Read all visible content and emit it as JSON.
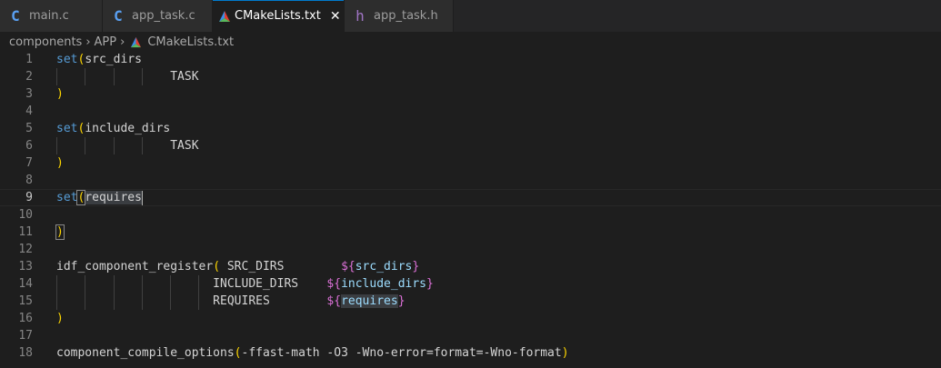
{
  "tabs": [
    {
      "icon": "C",
      "label": "main.c",
      "active": false
    },
    {
      "icon": "C",
      "label": "app_task.c",
      "active": false
    },
    {
      "icon": "cmake",
      "label": "CMakeLists.txt",
      "active": true
    },
    {
      "icon": "h",
      "label": "app_task.h",
      "active": false
    }
  ],
  "breadcrumb": [
    "components",
    "APP",
    "CMakeLists.txt"
  ],
  "colors": {
    "keyword": "#569cd6",
    "bracket": "#ffd700",
    "variable": "#9cdcfe",
    "dollar_brace": "#da70d6",
    "text": "#d4d4d4",
    "background": "#1e1e1e"
  },
  "current_line": 9,
  "lines": [
    {
      "n": "1",
      "tokens": [
        {
          "t": "set",
          "c": "fn"
        },
        {
          "t": "(",
          "c": "pn"
        },
        {
          "t": "src_dirs",
          "c": "plain"
        }
      ]
    },
    {
      "n": "2",
      "guides": 4,
      "tokens": [
        {
          "t": "                TASK",
          "c": "plain"
        }
      ]
    },
    {
      "n": "3",
      "tokens": [
        {
          "t": ")",
          "c": "pn"
        }
      ]
    },
    {
      "n": "4",
      "tokens": []
    },
    {
      "n": "5",
      "tokens": [
        {
          "t": "set",
          "c": "fn"
        },
        {
          "t": "(",
          "c": "pn"
        },
        {
          "t": "include_dirs",
          "c": "plain"
        }
      ]
    },
    {
      "n": "6",
      "guides": 4,
      "tokens": [
        {
          "t": "                TASK",
          "c": "plain"
        }
      ]
    },
    {
      "n": "7",
      "tokens": [
        {
          "t": ")",
          "c": "pn"
        }
      ]
    },
    {
      "n": "8",
      "tokens": []
    },
    {
      "n": "9",
      "tokens": [
        {
          "t": "set",
          "c": "fn"
        },
        {
          "t": "(",
          "c": "pn brk"
        },
        {
          "t": "requires",
          "c": "plain hl"
        }
      ]
    },
    {
      "n": "10",
      "tokens": []
    },
    {
      "n": "11",
      "tokens": [
        {
          "t": ")",
          "c": "pn brk"
        }
      ]
    },
    {
      "n": "12",
      "tokens": []
    },
    {
      "n": "13",
      "tokens": [
        {
          "t": "idf_component_register",
          "c": "plain"
        },
        {
          "t": "(",
          "c": "pn"
        },
        {
          "t": " SRC_DIRS        ",
          "c": "plain"
        },
        {
          "t": "${",
          "c": "dl"
        },
        {
          "t": "src_dirs",
          "c": "var"
        },
        {
          "t": "}",
          "c": "dl"
        }
      ]
    },
    {
      "n": "14",
      "guides": 6,
      "tokens": [
        {
          "t": "                      INCLUDE_DIRS    ",
          "c": "plain"
        },
        {
          "t": "${",
          "c": "dl"
        },
        {
          "t": "include_dirs",
          "c": "var"
        },
        {
          "t": "}",
          "c": "dl"
        }
      ]
    },
    {
      "n": "15",
      "guides": 6,
      "tokens": [
        {
          "t": "                      REQUIRES        ",
          "c": "plain"
        },
        {
          "t": "${",
          "c": "dl"
        },
        {
          "t": "requires",
          "c": "var hl"
        },
        {
          "t": "}",
          "c": "dl"
        }
      ]
    },
    {
      "n": "16",
      "tokens": [
        {
          "t": ")",
          "c": "pn"
        }
      ]
    },
    {
      "n": "17",
      "tokens": []
    },
    {
      "n": "18",
      "tokens": [
        {
          "t": "component_compile_options",
          "c": "plain"
        },
        {
          "t": "(",
          "c": "pn"
        },
        {
          "t": "-ffast-math -O3 -Wno-error=format=-Wno-format",
          "c": "plain"
        },
        {
          "t": ")",
          "c": "pn"
        }
      ]
    }
  ]
}
